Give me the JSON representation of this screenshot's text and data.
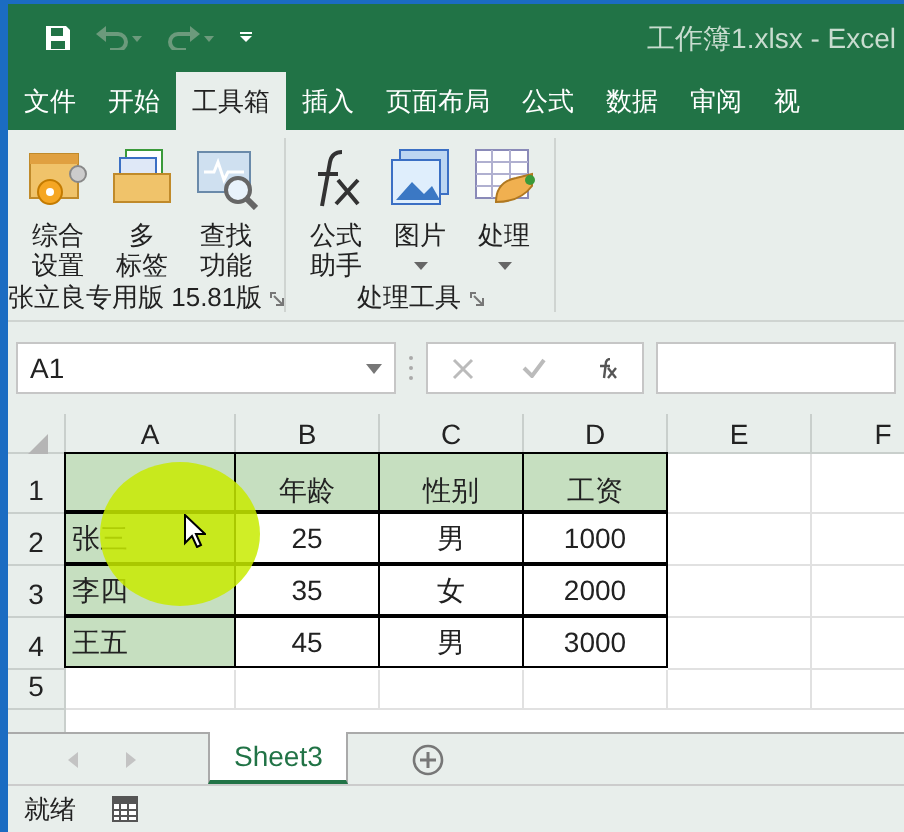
{
  "window": {
    "title": "工作簿1.xlsx  -  Excel"
  },
  "tabs": [
    {
      "label": "文件",
      "selected": false
    },
    {
      "label": "开始",
      "selected": false
    },
    {
      "label": "工具箱",
      "selected": true
    },
    {
      "label": "插入",
      "selected": false
    },
    {
      "label": "页面布局",
      "selected": false
    },
    {
      "label": "公式",
      "selected": false
    },
    {
      "label": "数据",
      "selected": false
    },
    {
      "label": "审阅",
      "selected": false
    },
    {
      "label": "视",
      "selected": false
    }
  ],
  "ribbon_groups": [
    {
      "label": "张立良专用版 15.81版",
      "buttons": [
        {
          "kind": "settings",
          "label_lines": [
            "综合",
            "设置"
          ],
          "dropdown": false
        },
        {
          "kind": "tabs",
          "label_lines": [
            "多",
            "标签"
          ],
          "dropdown": false
        },
        {
          "kind": "find",
          "label_lines": [
            "查找",
            "功能"
          ],
          "dropdown": false
        }
      ]
    },
    {
      "label": "处理工具",
      "buttons": [
        {
          "kind": "fx",
          "label_lines": [
            "公式",
            "助手"
          ],
          "dropdown": false
        },
        {
          "kind": "picture",
          "label_lines": [
            "图片"
          ],
          "dropdown": true
        },
        {
          "kind": "process",
          "label_lines": [
            "处理"
          ],
          "dropdown": true
        }
      ]
    }
  ],
  "name_box": "A1",
  "columns": [
    "A",
    "B",
    "C",
    "D",
    "E",
    "F"
  ],
  "rows": [
    {
      "header": "1",
      "cells": [
        {
          "filled": true
        },
        {
          "text": "年龄",
          "filled": true
        },
        {
          "text": "性别",
          "filled": true
        },
        {
          "text": "工资",
          "filled": true
        }
      ]
    },
    {
      "header": "2",
      "cells": [
        {
          "text": "张三",
          "filled": true
        },
        {
          "text": "25",
          "filled": false
        },
        {
          "text": "男",
          "filled": false
        },
        {
          "text": "1000",
          "filled": false
        }
      ]
    },
    {
      "header": "3",
      "cells": [
        {
          "text": "李四",
          "filled": true
        },
        {
          "text": "35",
          "filled": false
        },
        {
          "text": "女",
          "filled": false
        },
        {
          "text": "2000",
          "filled": false
        }
      ]
    },
    {
      "header": "4",
      "cells": [
        {
          "text": "王五",
          "filled": true
        },
        {
          "text": "45",
          "filled": false
        },
        {
          "text": "男",
          "filled": false
        },
        {
          "text": "3000",
          "filled": false
        }
      ]
    },
    {
      "header": "5",
      "cells": []
    }
  ],
  "sheet_tabs": [
    {
      "label": "Sheet3",
      "selected": true
    }
  ],
  "status_bar": {
    "text": "就绪"
  }
}
